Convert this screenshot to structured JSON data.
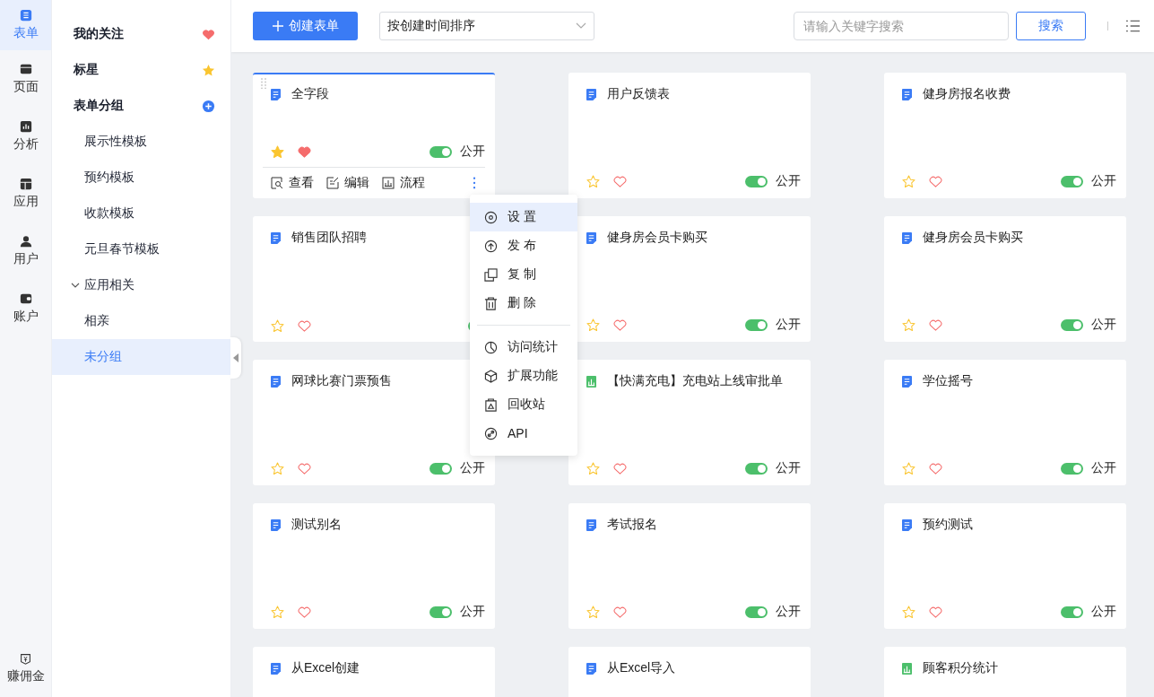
{
  "rail": [
    {
      "label": "表单",
      "selected": true
    },
    {
      "label": "页面",
      "selected": false
    },
    {
      "label": "分析",
      "selected": false
    },
    {
      "label": "应用",
      "selected": false
    },
    {
      "label": "用户",
      "selected": false
    },
    {
      "label": "账户",
      "selected": false
    }
  ],
  "rail_bottom": {
    "label": "赚佣金"
  },
  "sidebar": {
    "headers": [
      {
        "label": "我的关注"
      },
      {
        "label": "标星"
      },
      {
        "label": "表单分组"
      }
    ],
    "groups": [
      {
        "label": "展示性模板",
        "selected": false
      },
      {
        "label": "预约模板",
        "selected": false
      },
      {
        "label": "收款模板",
        "selected": false
      },
      {
        "label": "元旦春节模板",
        "selected": false
      },
      {
        "label": "应用相关",
        "selected": false,
        "expanded": true,
        "children": [
          {
            "label": "相亲",
            "selected": false
          }
        ]
      },
      {
        "label": "未分组",
        "selected": true
      }
    ]
  },
  "toolbar": {
    "create_button": "创建表单",
    "sort": "按创建时间排序",
    "search_placeholder": "请输入关键字搜索",
    "search_button": "搜索"
  },
  "cards": [
    {
      "title": "全字段",
      "kind": "form",
      "starred": true,
      "liked": true,
      "public": true,
      "label": "公开",
      "hovered": true,
      "actions": [
        "查看",
        "编辑",
        "流程"
      ]
    },
    {
      "title": "用户反馈表",
      "kind": "form",
      "starred": false,
      "liked": false,
      "public": true,
      "label": "公开",
      "hovered": false
    },
    {
      "title": "健身房报名收费",
      "kind": "form",
      "starred": false,
      "liked": false,
      "public": true,
      "label": "公开",
      "hovered": false
    },
    {
      "title": "销售团队招聘",
      "kind": "form",
      "starred": false,
      "liked": false,
      "public": true,
      "hovered": false
    },
    {
      "title": "健身房会员卡购买",
      "kind": "form",
      "starred": false,
      "liked": false,
      "public": true,
      "label": "公开",
      "hovered": false
    },
    {
      "title": "健身房会员卡购买",
      "kind": "form",
      "starred": false,
      "liked": false,
      "public": true,
      "label": "公开",
      "hovered": false
    },
    {
      "title": "网球比赛门票预售",
      "kind": "form",
      "starred": false,
      "liked": false,
      "public": true,
      "label": "公开",
      "hovered": false
    },
    {
      "title": "【快满充电】充电站上线审批单",
      "kind": "report",
      "starred": false,
      "liked": false,
      "public": true,
      "label": "公开",
      "hovered": false
    },
    {
      "title": "学位摇号",
      "kind": "form",
      "starred": false,
      "liked": false,
      "public": true,
      "label": "公开",
      "hovered": false
    },
    {
      "title": "测试别名",
      "kind": "form",
      "starred": false,
      "liked": false,
      "public": true,
      "label": "公开",
      "hovered": false
    },
    {
      "title": "考试报名",
      "kind": "form",
      "starred": false,
      "liked": false,
      "public": true,
      "label": "公开",
      "hovered": false
    },
    {
      "title": "预约测试",
      "kind": "form",
      "starred": false,
      "liked": false,
      "public": true,
      "label": "公开",
      "hovered": false
    },
    {
      "title": "从Excel创建",
      "kind": "form",
      "hovered": false
    },
    {
      "title": "从Excel导入",
      "kind": "form",
      "hovered": false
    },
    {
      "title": "顾客积分统计",
      "kind": "report",
      "hovered": false
    }
  ],
  "menu": [
    {
      "label": "设 置",
      "selected": true
    },
    {
      "label": "发 布",
      "selected": false
    },
    {
      "label": "复 制",
      "selected": false
    },
    {
      "label": "删 除",
      "selected": false,
      "divider_after": true
    },
    {
      "label": "访问统计",
      "selected": false
    },
    {
      "label": "扩展功能",
      "selected": false
    },
    {
      "label": "回收站",
      "selected": false
    },
    {
      "label": "API",
      "selected": false
    }
  ]
}
